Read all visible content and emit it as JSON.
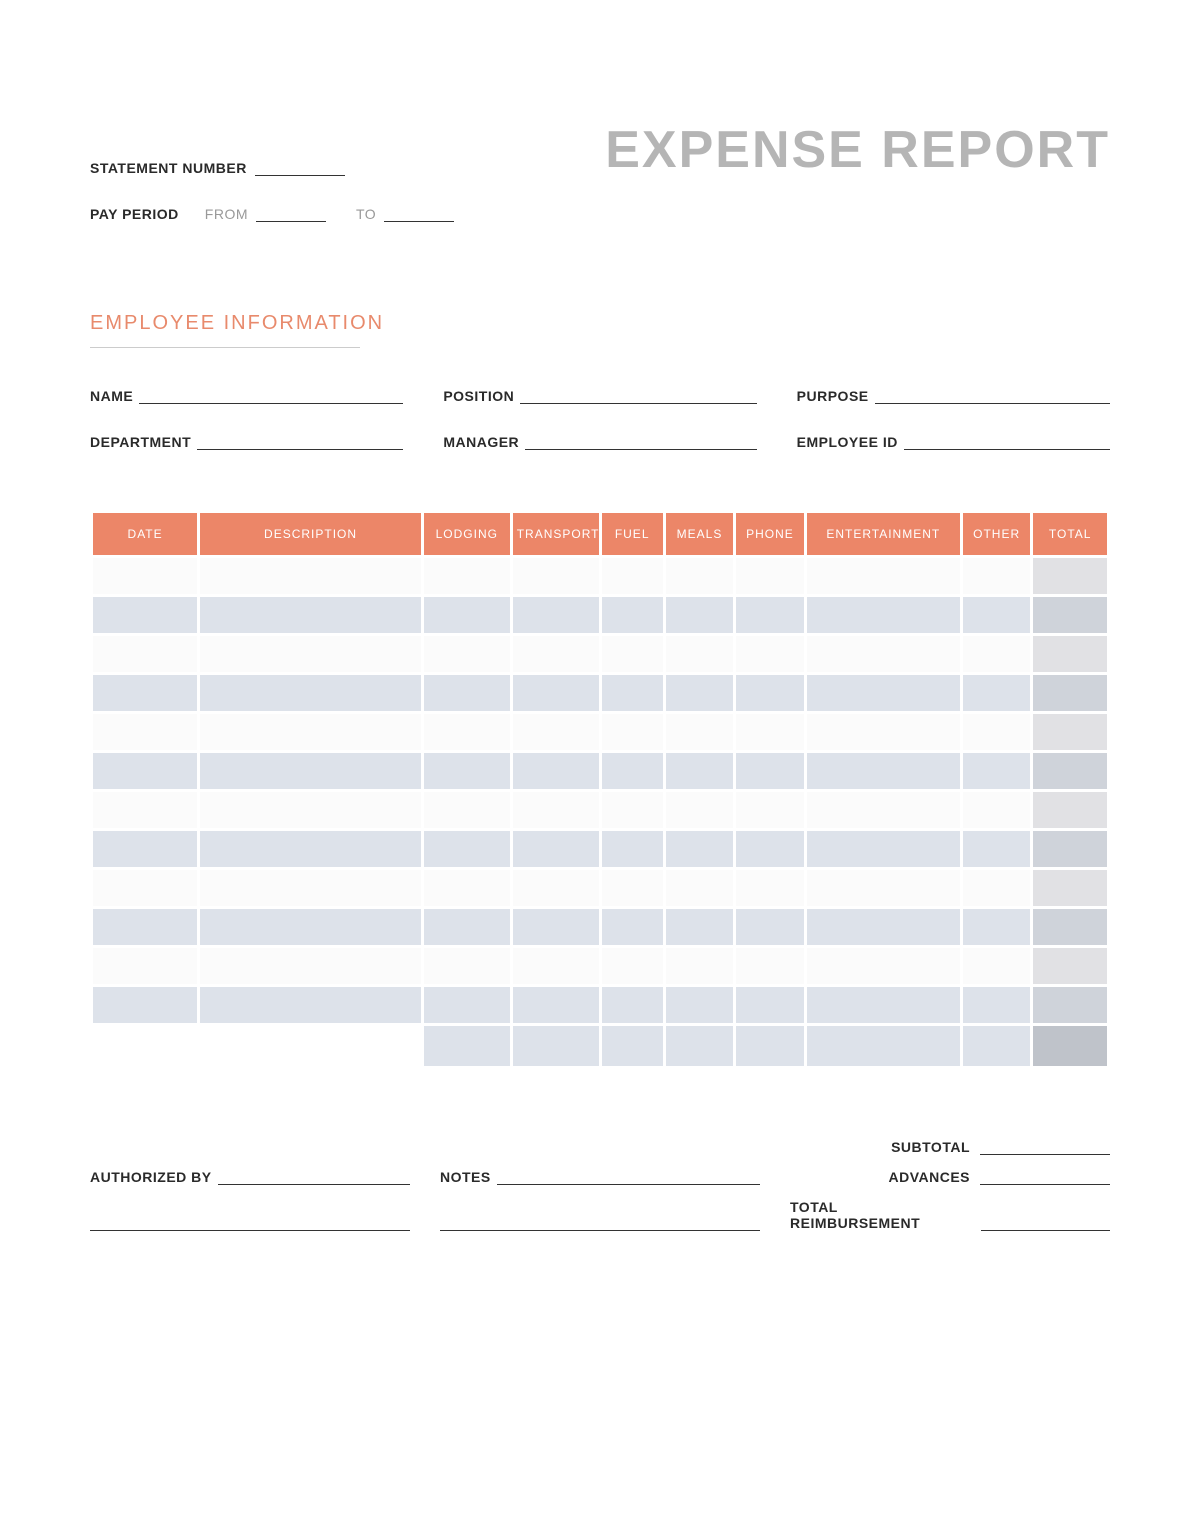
{
  "header": {
    "title": "EXPENSE REPORT",
    "statement_label": "STATEMENT NUMBER",
    "pay_period_label": "PAY PERIOD",
    "from_label": "FROM",
    "to_label": "TO"
  },
  "employee_section": {
    "heading": "EMPLOYEE INFORMATION",
    "fields": {
      "name": "NAME",
      "position": "POSITION",
      "purpose": "PURPOSE",
      "department": "DEPARTMENT",
      "manager": "MANAGER",
      "employee_id": "EMPLOYEE ID"
    }
  },
  "table": {
    "headers": {
      "date": "DATE",
      "description": "DESCRIPTION",
      "lodging": "LODGING",
      "transport": "TRANSPORT",
      "fuel": "FUEL",
      "meals": "MEALS",
      "phone": "PHONE",
      "entertainment": "ENTERTAINMENT",
      "other": "OTHER",
      "total": "TOTAL"
    },
    "row_count": 12
  },
  "footer": {
    "authorized_by": "AUTHORIZED BY",
    "notes": "NOTES",
    "subtotal": "SUBTOTAL",
    "advances": "ADVANCES",
    "total_reimbursement": "TOTAL REIMBURSEMENT"
  }
}
